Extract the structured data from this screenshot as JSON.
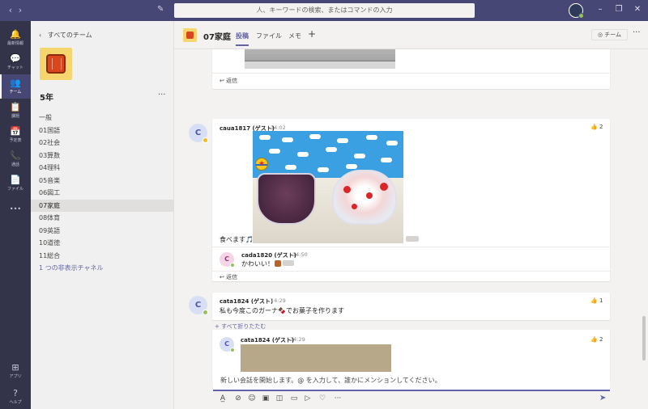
{
  "titlebar": {
    "search_placeholder": "人、キーワードの検索、またはコマンドの入力",
    "back_glyph": "‹",
    "forward_glyph": "›",
    "compose_glyph": "✎",
    "minimize_glyph": "–",
    "maximize_glyph": "❐",
    "close_glyph": "✕"
  },
  "rail": {
    "items": [
      {
        "icon": "bell-icon",
        "glyph": "🔔",
        "label": "最新情報"
      },
      {
        "icon": "chat-icon",
        "glyph": "💬",
        "label": "チャット"
      },
      {
        "icon": "teams-icon",
        "glyph": "👥",
        "label": "チーム"
      },
      {
        "icon": "assignments-icon",
        "glyph": "📋",
        "label": "課題"
      },
      {
        "icon": "calendar-icon",
        "glyph": "📅",
        "label": "予定表"
      },
      {
        "icon": "calls-icon",
        "glyph": "📞",
        "label": "通話"
      },
      {
        "icon": "files-icon",
        "glyph": "📄",
        "label": "ファイル"
      },
      {
        "icon": "more-apps-icon",
        "glyph": "•••",
        "label": ""
      }
    ],
    "bottom": [
      {
        "icon": "apps-icon",
        "glyph": "⊞",
        "label": "アプリ"
      },
      {
        "icon": "help-icon",
        "glyph": "?",
        "label": "ヘルプ"
      }
    ]
  },
  "team_panel": {
    "back_label": "すべてのチーム",
    "back_glyph": "‹",
    "team_name": "5年",
    "more_glyph": "···",
    "channels": [
      "一般",
      "01国語",
      "02社会",
      "03算数",
      "04理科",
      "05音楽",
      "06図工",
      "07家庭",
      "08体育",
      "09英語",
      "10道徳",
      "11総合"
    ],
    "active_channel": "07家庭",
    "hidden_channels_label": "1 つの非表示チャネル"
  },
  "header": {
    "channel_title": "07家庭",
    "tabs": [
      "投稿",
      "ファイル",
      "メモ"
    ],
    "add_tab_glyph": "+",
    "team_chip": "◎ チーム",
    "more_glyph": "···"
  },
  "feed": {
    "reply_label": "↩ 返信",
    "messages": [
      {
        "author": "caua1817 (ゲスト)",
        "time": "14:02",
        "avatar": "C",
        "text": "食べます🎵",
        "reaction_count": "2",
        "replies": [
          {
            "author": "cada1820 (ゲスト)",
            "time": "14:50",
            "avatar": "C",
            "text": "かわいい！"
          }
        ]
      },
      {
        "author": "cata1824 (ゲスト)",
        "time": "14:29",
        "avatar": "C",
        "text": "私も今度このガーナ🍫でお菓子を作ります",
        "reaction_count": "1",
        "collapse_label": "+ すべて折りたたむ",
        "replies": [
          {
            "author": "cata1824 (ゲスト)",
            "time": "14:29",
            "avatar": "C",
            "reaction_count": "2"
          }
        ]
      }
    ]
  },
  "compose": {
    "placeholder": "新しい会話を開始します。@ を入力して、誰かにメンションしてください。",
    "tools": [
      {
        "icon": "format-icon",
        "glyph": "A̲"
      },
      {
        "icon": "attach-icon",
        "glyph": "⊘"
      },
      {
        "icon": "emoji-icon",
        "glyph": "☺"
      },
      {
        "icon": "gif-icon",
        "glyph": "▣"
      },
      {
        "icon": "sticker-icon",
        "glyph": "◫"
      },
      {
        "icon": "meet-icon",
        "glyph": "▭"
      },
      {
        "icon": "stream-icon",
        "glyph": "▷"
      },
      {
        "icon": "praise-icon",
        "glyph": "♡"
      },
      {
        "icon": "more-options-icon",
        "glyph": "···"
      }
    ],
    "send_glyph": "➤"
  },
  "colors": {
    "titlebar": "#464775",
    "rail": "#33344a",
    "accent": "#6264a7",
    "away": "#fdb913",
    "online": "#92c353"
  }
}
